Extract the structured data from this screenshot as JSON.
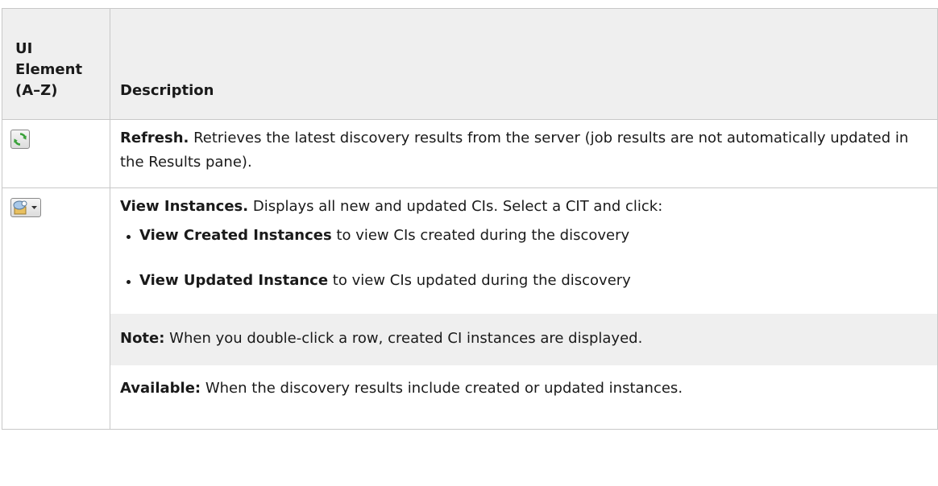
{
  "table": {
    "headers": {
      "ui_element": [
        "UI",
        "Element",
        "(A–Z)"
      ],
      "description": "Description"
    },
    "rows": [
      {
        "icon": "refresh-icon",
        "title": "Refresh.",
        "text": " Retrieves the latest discovery results from the server (job results are not automatically updated in the Results pane)."
      },
      {
        "icon": "view-instances-icon",
        "title": "View Instances.",
        "text": " Displays all new and updated CIs. Select a CIT and click:",
        "bullets": [
          {
            "bold": "View Created Instances",
            "text": " to view CIs created during the discovery"
          },
          {
            "bold": "View Updated Instance",
            "text": " to view CIs updated during the discovery"
          }
        ],
        "note": {
          "label": "Note:",
          "text": " When you double-click a row, created CI instances are displayed."
        },
        "available": {
          "label": "Available:",
          "text": " When the discovery results include created or updated instances."
        }
      }
    ]
  },
  "colors": {
    "header_bg": "#efefef",
    "border": "#c8c8c8",
    "note_bg": "#efefef",
    "refresh_green": "#3aa23a"
  }
}
